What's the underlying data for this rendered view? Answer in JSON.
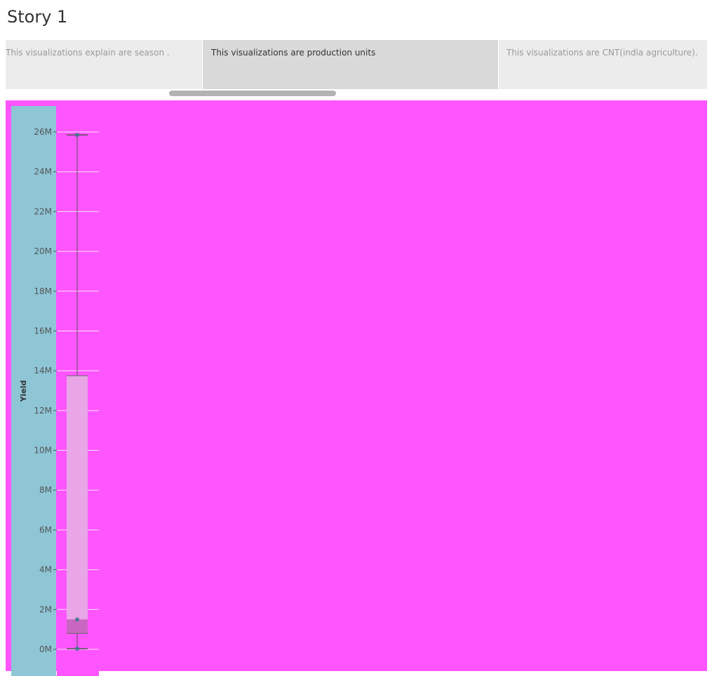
{
  "story": {
    "title": "Story 1"
  },
  "navigator": {
    "points": [
      {
        "label": "This visualizations explain  are season ."
      },
      {
        "label": "This visualizations are production units"
      },
      {
        "label": "This visualizations are CNT(india agriculture)."
      }
    ],
    "selected_index": 1
  },
  "colors": {
    "dashboard_background": "#ff55ff",
    "axis_panel": "#8ec6d6",
    "box_upper": "#e8a6e6",
    "box_lower": "#c866c2",
    "whisker": "#555555",
    "point": "#3a7a8c"
  },
  "chart_data": {
    "type": "box",
    "ylabel": "Yield",
    "ylim": [
      0,
      26000000
    ],
    "y_ticks": [
      0,
      2000000,
      4000000,
      6000000,
      8000000,
      10000000,
      12000000,
      14000000,
      16000000,
      18000000,
      20000000,
      22000000,
      24000000,
      26000000
    ],
    "y_tick_labels": [
      "0M",
      "2M",
      "4M",
      "6M",
      "8M",
      "10M",
      "12M",
      "14M",
      "16M",
      "18M",
      "20M",
      "22M",
      "24M",
      "26M"
    ],
    "grid": true,
    "box": {
      "lower_whisker": 30000,
      "q1": 800000,
      "median": 1500000,
      "q3": 13750000,
      "upper_whisker": 25850000
    },
    "points": [
      30000,
      1500000,
      25850000
    ]
  }
}
